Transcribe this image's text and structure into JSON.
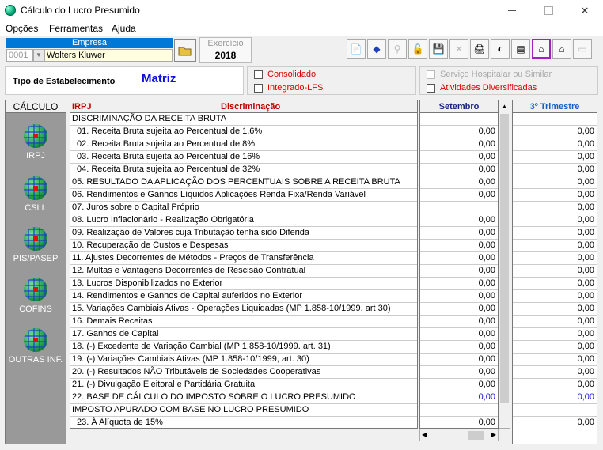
{
  "window": {
    "title": "Cálculo do Lucro Presumido"
  },
  "menu": [
    "Opções",
    "Ferramentas",
    "Ajuda"
  ],
  "empresa": {
    "header": "Empresa",
    "code": "0001",
    "name": "Wolters Kluwer"
  },
  "exercicio": {
    "label": "Exercício",
    "value": "2018"
  },
  "estabelecimento": {
    "label": "Tipo de Estabelecimento",
    "value": "Matriz"
  },
  "checks": {
    "consolidado": "Consolidado",
    "integrado": "Integrado-LFS",
    "servico": "Serviço Hospitalar ou Similar",
    "atividades": "Atividades Diversificadas"
  },
  "sidebar": {
    "header": "CÁLCULO",
    "items": [
      "IRPJ",
      "CSLL",
      "PIS/PASEP",
      "COFINS",
      "OUTRAS INF."
    ]
  },
  "grid": {
    "col_irpj": "IRPJ",
    "col_disc": "Discriminação",
    "col_month": "Setembro",
    "col_trim": "3º Trimestre",
    "rows": [
      {
        "label": "DISCRIMINAÇÃO DA RECEITA BRUTA",
        "month": "",
        "trim": ""
      },
      {
        "label": "01. Receita Bruta sujeita ao Percentual de 1,6%",
        "month": "0,00",
        "trim": "0,00"
      },
      {
        "label": "02. Receita Bruta sujeita ao Percentual de 8%",
        "month": "0,00",
        "trim": "0,00"
      },
      {
        "label": "03. Receita Bruta sujeita ao Percentual de 16%",
        "month": "0,00",
        "trim": "0,00"
      },
      {
        "label": "04. Receita Bruta sujeita ao Percentual de 32%",
        "month": "0,00",
        "trim": "0,00"
      },
      {
        "label": "05. RESULTADO DA APLICAÇÃO DOS PERCENTUAIS SOBRE A RECEITA BRUTA",
        "month": "0,00",
        "trim": "0,00"
      },
      {
        "label": "06. Rendimentos e Ganhos Líquidos Aplicações Renda Fixa/Renda Variável",
        "month": "0,00",
        "trim": "0,00"
      },
      {
        "label": "07. Juros sobre o Capital Próprio",
        "month": "",
        "trim": "0,00"
      },
      {
        "label": "08. Lucro Inflacionário - Realização Obrigatória",
        "month": "0,00",
        "trim": "0,00"
      },
      {
        "label": "09. Realização de Valores cuja Tributação tenha sido Diferida",
        "month": "0,00",
        "trim": "0,00"
      },
      {
        "label": "10. Recuperação de Custos e Despesas",
        "month": "0,00",
        "trim": "0,00"
      },
      {
        "label": "11. Ajustes Decorrentes de Métodos - Preços de Transferência",
        "month": "0,00",
        "trim": "0,00"
      },
      {
        "label": "12. Multas e Vantagens Decorrentes de Rescisão Contratual",
        "month": "0,00",
        "trim": "0,00"
      },
      {
        "label": "13. Lucros Disponibilizados no Exterior",
        "month": "0,00",
        "trim": "0,00"
      },
      {
        "label": "14. Rendimentos e Ganhos de Capital auferidos no Exterior",
        "month": "0,00",
        "trim": "0,00"
      },
      {
        "label": "15. Variações Cambiais Ativas - Operações Liquidadas (MP 1.858-10/1999, art 30)",
        "month": "0,00",
        "trim": "0,00"
      },
      {
        "label": "16. Demais Receitas",
        "month": "0,00",
        "trim": "0,00"
      },
      {
        "label": "17. Ganhos de Capital",
        "month": "0,00",
        "trim": "0,00"
      },
      {
        "label": "18. (-) Excedente de Variação Cambial (MP 1.858-10/1999. art. 31)",
        "month": "0,00",
        "trim": "0,00"
      },
      {
        "label": "19. (-) Variações Cambiais Ativas (MP 1.858-10/1999, art. 30)",
        "month": "0,00",
        "trim": "0,00"
      },
      {
        "label": "20. (-) Resultados NÃO Tributáveis de Sociedades Cooperativas",
        "month": "0,00",
        "trim": "0,00"
      },
      {
        "label": "21. (-) Divulgação Eleitoral e Partidária Gratuita",
        "month": "0,00",
        "trim": "0,00"
      },
      {
        "label": "22. BASE DE CÁLCULO DO IMPOSTO SOBRE O LUCRO PRESUMIDO",
        "month": "0,00",
        "trim": "0,00"
      },
      {
        "label": "IMPOSTO APURADO COM BASE NO LUCRO PRESUMIDO",
        "month": "",
        "trim": ""
      },
      {
        "label": "23. À Alíquota de 15%",
        "month": "0,00",
        "trim": "0,00"
      }
    ]
  }
}
